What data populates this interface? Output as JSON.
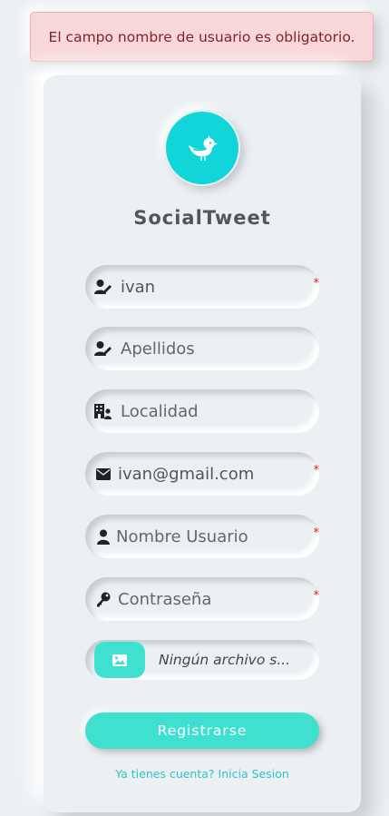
{
  "alert": {
    "message": "El campo nombre de usuario es obligatorio."
  },
  "brand": {
    "name": "SocialTweet"
  },
  "colors": {
    "accent": "#40e0d0",
    "logo_bg": "#11d5d9",
    "required": "#e02020",
    "alert_bg": "#f8d7da",
    "alert_text": "#842029"
  },
  "form": {
    "nombre": {
      "value": "ivan",
      "icon": "user-pen-icon",
      "required": true,
      "required_mark": "*"
    },
    "apellidos": {
      "placeholder": "Apellidos",
      "icon": "user-pen-icon"
    },
    "localidad": {
      "placeholder": "Localidad",
      "icon": "building-user-icon"
    },
    "email": {
      "value": "ivan@gmail.com",
      "icon": "envelope-icon",
      "required": true,
      "required_mark": "*"
    },
    "usuario": {
      "placeholder": "Nombre Usuario",
      "icon": "user-icon",
      "required": true,
      "required_mark": "*"
    },
    "password": {
      "placeholder": "Contraseña",
      "icon": "key-icon",
      "required": true,
      "required_mark": "*"
    },
    "file": {
      "label": "Ningún archivo s...",
      "icon": "image-icon"
    },
    "submit_label": "Registrarse",
    "login_link": "Ya tienes cuenta? Inicia Sesion"
  }
}
